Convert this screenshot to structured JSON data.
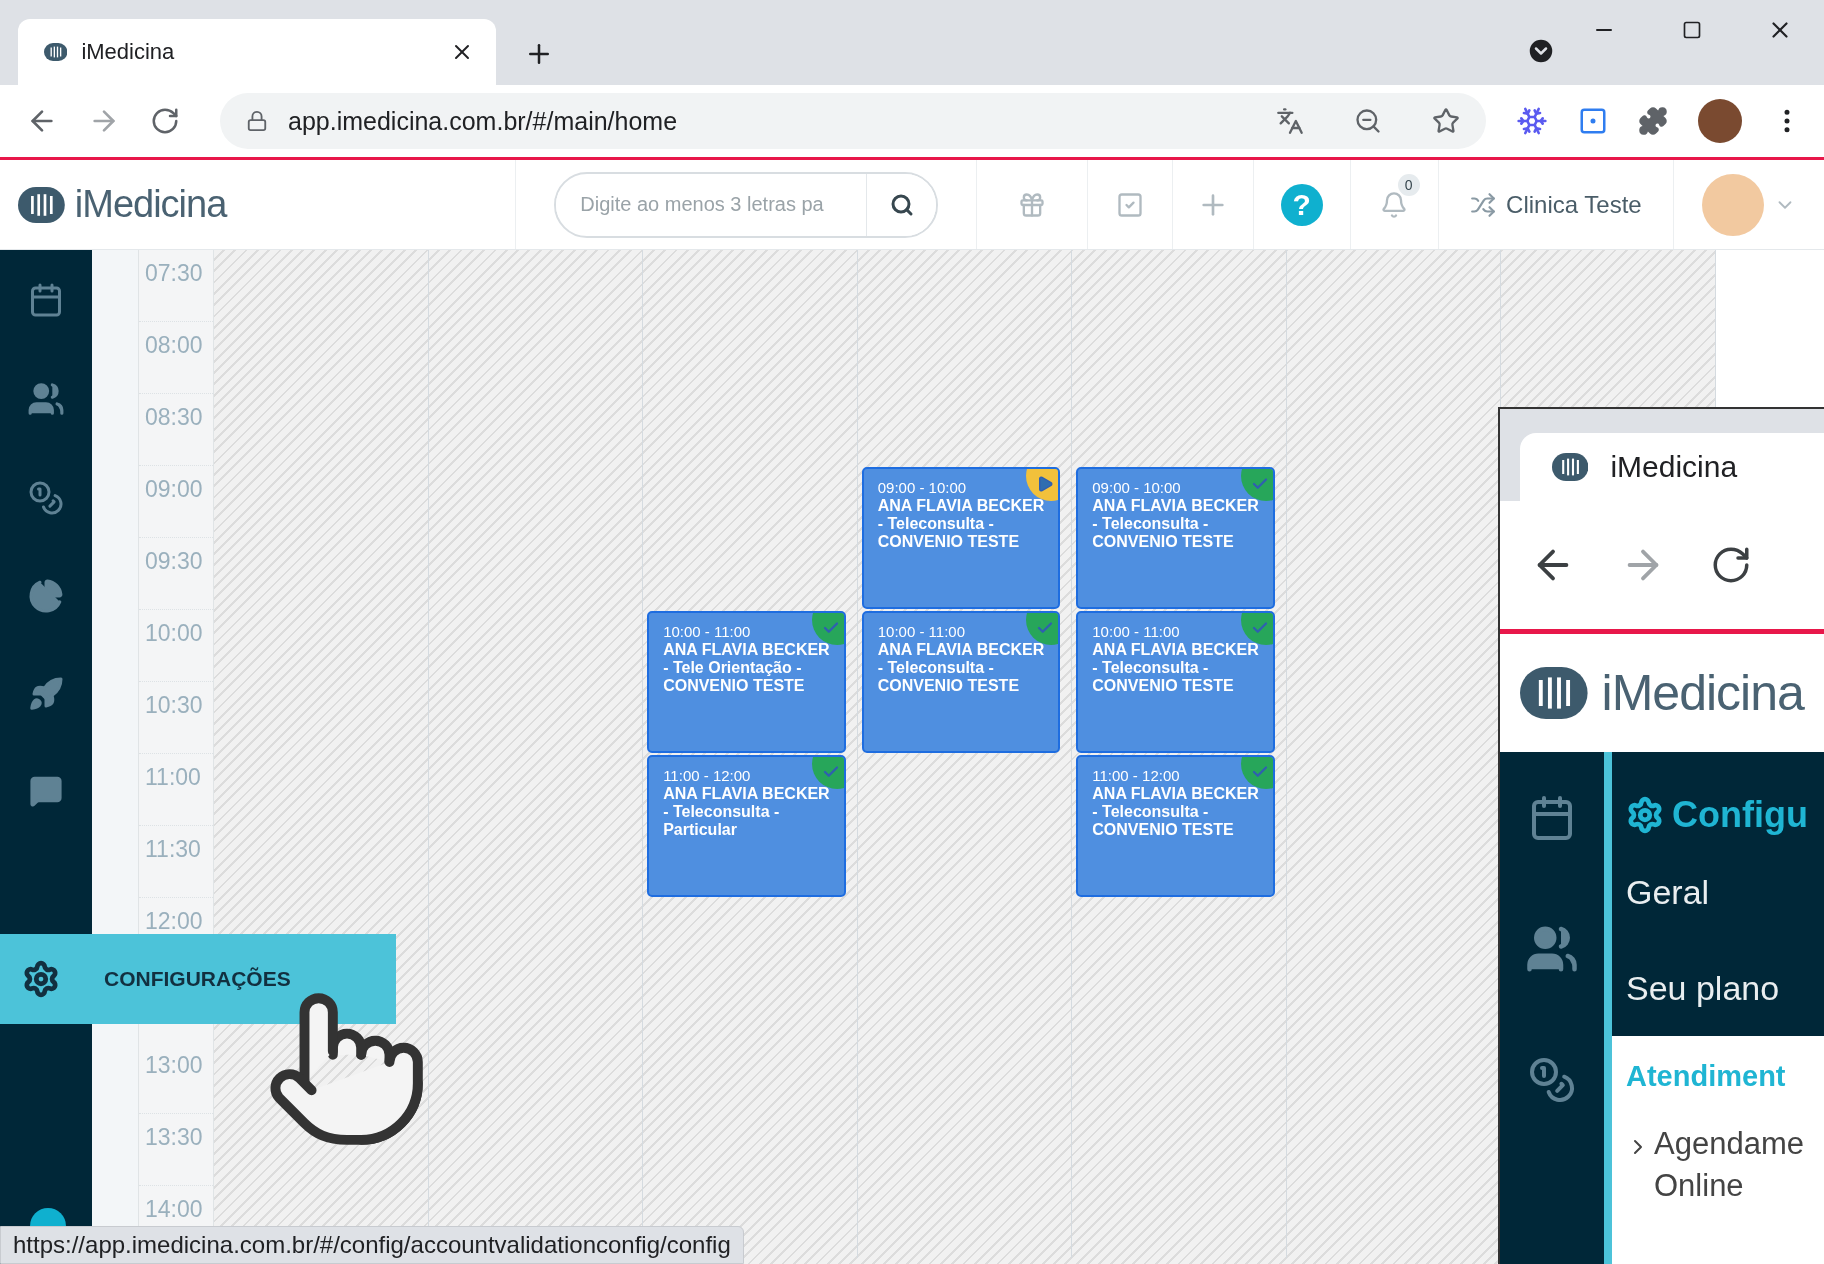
{
  "browser": {
    "tab": {
      "title": "iMedicina"
    },
    "address": "app.imedicina.com.br/#/main/home"
  },
  "header": {
    "logo": "iMedicina",
    "search": {
      "placeholder": "Digite ao menos 3 letras pa"
    },
    "help": "?",
    "notifications": "0",
    "clinic": "Clinica Teste"
  },
  "calendar": {
    "times": [
      "07:30",
      "08:00",
      "08:30",
      "09:00",
      "09:30",
      "10:00",
      "10:30",
      "11:00",
      "11:30",
      "12:00",
      "13:00",
      "13:30",
      "14:00"
    ],
    "columns": [
      {},
      {},
      {
        "events": [
          {
            "time": "10:00 - 11:00",
            "title": "ANA FLAVIA BECKER - Tele Orientação - CONVENIO TESTE",
            "kind": "confirmed"
          },
          {
            "time": "11:00 - 12:00",
            "title": "ANA FLAVIA BECKER - Teleconsulta - Particular",
            "kind": "confirmed"
          }
        ]
      },
      {
        "events": [
          {
            "time": "09:00 - 10:00",
            "title": "ANA FLAVIA BECKER - Teleconsulta - CONVENIO TESTE",
            "kind": "started"
          },
          {
            "time": "10:00 - 11:00",
            "title": "ANA FLAVIA BECKER - Teleconsulta - CONVENIO TESTE",
            "kind": "confirmed"
          }
        ]
      },
      {
        "events": [
          {
            "time": "09:00 - 10:00",
            "title": "ANA FLAVIA BECKER - Teleconsulta - CONVENIO TESTE",
            "kind": "confirmed"
          },
          {
            "time": "10:00 - 11:00",
            "title": "ANA FLAVIA BECKER - Teleconsulta - CONVENIO TESTE",
            "kind": "confirmed"
          },
          {
            "time": "11:00 - 12:00",
            "title": "ANA FLAVIA BECKER - Teleconsulta - CONVENIO TESTE",
            "kind": "confirmed"
          }
        ]
      },
      {},
      {}
    ]
  },
  "flyout": {
    "label": "CONFIGURAÇÕES"
  },
  "status_url": "https://app.imedicina.com.br/#/config/accountvalidationconfig/config",
  "inset": {
    "tab_title": "iMedicina",
    "logo": "iMedicina",
    "menu_title": "Configu",
    "menu_items": [
      "Geral",
      "Seu plano"
    ],
    "section_title": "Atendiment",
    "section_items": [
      "Agendame Online"
    ]
  }
}
